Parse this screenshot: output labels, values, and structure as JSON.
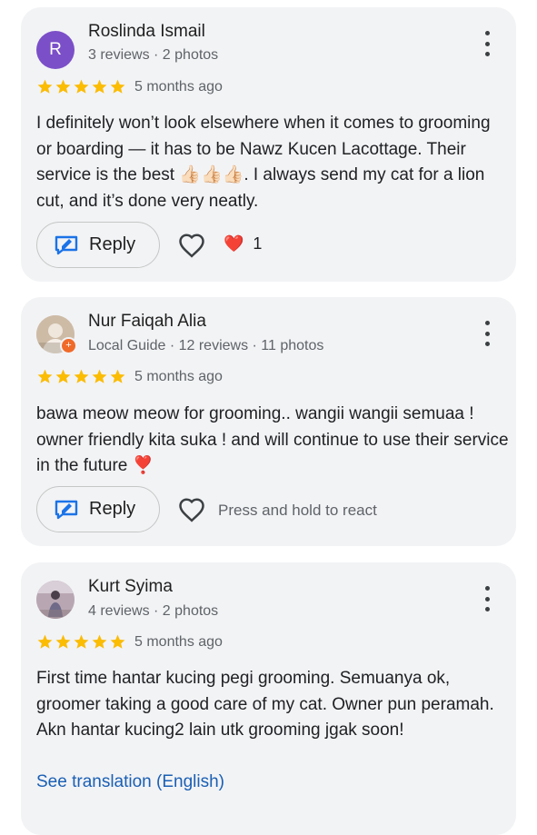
{
  "reviews": [
    {
      "avatar_letter": "R",
      "avatar_color": "#7b4fc8",
      "name": "Roslinda Ismail",
      "meta": "3 reviews · 2 photos",
      "date": "5 months ago",
      "rating": 5,
      "text": "I definitely won’t look elsewhere when it comes to grooming or boarding — it has to be Nawz Kucen Lacottage. Their service is the best 👍🏻👍🏻👍🏻. I always send my cat for a lion cut, and it’s done very neatly.",
      "reply_label": "Reply",
      "reaction_emoji": "❤️",
      "reaction_count": "1"
    },
    {
      "avatar_color": "#d9c9b4",
      "name": "Nur Faiqah Alia",
      "meta": "Local Guide · 12 reviews · 11 photos",
      "date": "5 months ago",
      "rating": 5,
      "text": "bawa meow meow for grooming.. wangii wangii semuaa ! owner friendly kita suka ! and will continue to use their service in the future ❣️",
      "reply_label": "Reply",
      "react_hint": "Press and hold to react"
    },
    {
      "avatar_color": "#c9b9c2",
      "name": "Kurt Syima",
      "meta": "4 reviews · 2 photos",
      "date": "5 months ago",
      "rating": 5,
      "text": "First time hantar kucing pegi grooming. Semuanya ok, groomer taking a good care of my cat. Owner pun peramah. Akn hantar kucing2 lain utk grooming jgak soon!",
      "translation_link": "See translation (English)"
    }
  ],
  "colors": {
    "star": "#fbbc04",
    "link": "#1a5fb4",
    "reply_icon": "#1a73e8"
  }
}
